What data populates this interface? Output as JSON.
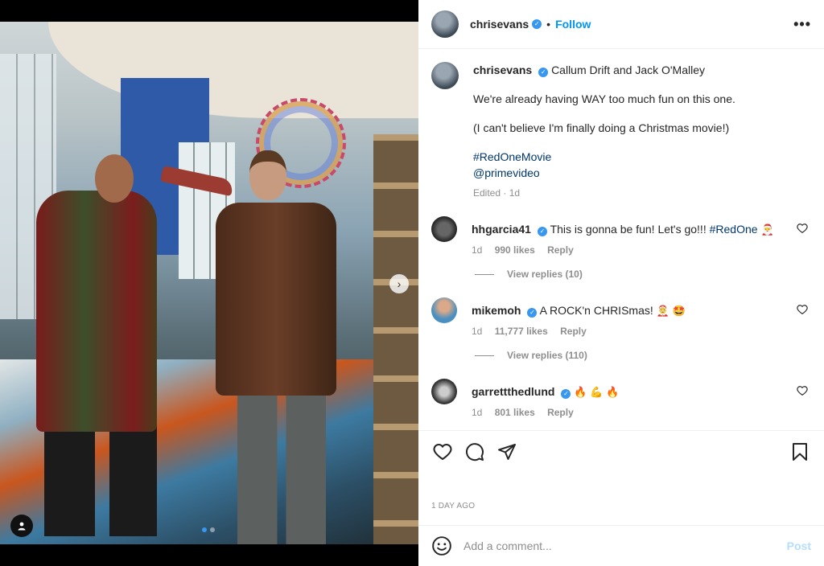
{
  "post": {
    "author": "chrisevans",
    "follow_label": "Follow",
    "separator": "•",
    "more_icon": "more-horizontal-icon",
    "carousel": {
      "slide_count": 2,
      "current_slide": 1
    }
  },
  "caption": {
    "username": "chrisevans",
    "line1": "Callum Drift and Jack O'Malley",
    "line2": "We're already having WAY too much fun on this one.",
    "line3": "(I can't believe I'm finally doing a Christmas movie!)",
    "hashtag": "#RedOneMovie",
    "mention": "@primevideo",
    "edited": "Edited · 1d"
  },
  "comments": [
    {
      "username": "hhgarcia41",
      "verified": true,
      "text": "This is gonna be fun! Let's go!!! ",
      "hashtag": "#RedOne",
      "emoji": "🎅",
      "time": "1d",
      "likes": "990 likes",
      "reply": "Reply",
      "view_replies": "View replies (10)"
    },
    {
      "username": "mikemoh",
      "verified": true,
      "text": "A ROCK'n CHRISmas! ",
      "emoji": "🤶 🤩",
      "time": "1d",
      "likes": "11,777 likes",
      "reply": "Reply",
      "view_replies": "View replies (110)"
    },
    {
      "username": "garrettthedlund",
      "verified": true,
      "text": "",
      "emoji": "🔥 💪 🔥",
      "time": "1d",
      "likes": "801 likes",
      "reply": "Reply"
    }
  ],
  "actions": {
    "date": "1 DAY AGO"
  },
  "add_comment": {
    "placeholder": "Add a comment...",
    "post_label": "Post"
  },
  "colors": {
    "accent": "#0095f6",
    "verified": "#3897f0",
    "muted": "#8e8e8e"
  }
}
